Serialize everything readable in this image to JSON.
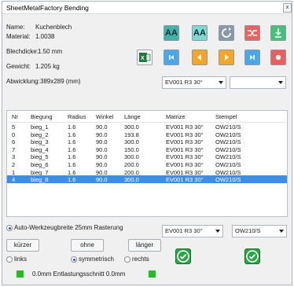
{
  "window": {
    "title": "SheetMetalFactory Bending",
    "close_glyph": "x"
  },
  "info": {
    "name_label": "Name:",
    "name_value": "Kuchenblech",
    "material_label": "Material:",
    "material_value": "1.0038",
    "thickness_label": "Blechdicke:",
    "thickness_value": "1.50 mm",
    "weight_label": "Gewicht:",
    "weight_value": "1.205 kg",
    "unfold_label": "Abwicklung:",
    "unfold_value": "389x289 (mm)"
  },
  "toolbar": {
    "aa_label": "AA"
  },
  "top_combos": {
    "matrize": "EV001 R3 30°",
    "second": ""
  },
  "table": {
    "headers": [
      "Nr",
      "Biegung",
      "Radius",
      "Winkel",
      "Länge",
      "Matrize",
      "Stempel"
    ],
    "rows": [
      [
        "5",
        "bieg_1",
        "1.6",
        "90.0",
        "300.0",
        "EV001 R3 30°",
        "OW210/S"
      ],
      [
        "0",
        "bieg_2",
        "1.6",
        "90.0",
        "193.8",
        "EV001 R3 30°",
        "OW210/S"
      ],
      [
        "6",
        "bieg_3",
        "1.6",
        "90.0",
        "300.0",
        "EV001 R3 30°",
        "OW210/S"
      ],
      [
        "7",
        "bieg_4",
        "1.6",
        "90.0",
        "150.0",
        "EV001 R3 30°",
        "OW210/S"
      ],
      [
        "3",
        "bieg_5",
        "1.6",
        "90.0",
        "300.0",
        "EV001 R3 30°",
        "OW210/S"
      ],
      [
        "2",
        "bieg_6",
        "1.6",
        "90.0",
        "200.0",
        "EV001 R3 30°",
        "OW210/S"
      ],
      [
        "1",
        "bieg_7",
        "1.6",
        "90.0",
        "200.0",
        "EV001 R3 30°",
        "OW210/S"
      ],
      [
        "4",
        "bieg_8",
        "1.6",
        "90.0",
        "300.0",
        "EV001 R3 30°",
        "OW210/S"
      ]
    ],
    "selected_index": 7
  },
  "bottom": {
    "auto_label": "Auto-Werkzeugbreite 25mm Rasterung",
    "kuerzer": "kürzer",
    "ohne": "ohne",
    "laenger": "länger",
    "links": "links",
    "symmetrisch": "symmetrisch",
    "rechts": "rechts",
    "status_text": "0.0mm  Entlastungsschnitt 0.0mm",
    "matrize_combo": "EV001 R3 30°",
    "stempel_combo": "OW210/S"
  },
  "colors": {
    "accent_teal": "#3fb3a6",
    "selection": "#3d8ee8",
    "ok_green": "#28a745",
    "status_green": "#20c020"
  }
}
